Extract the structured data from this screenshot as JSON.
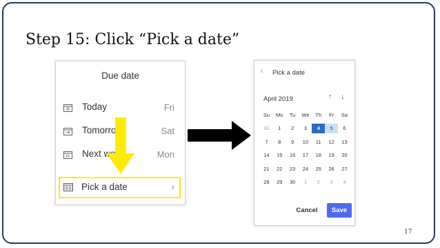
{
  "slide": {
    "title": "Step 15: Click “Pick a date”",
    "page_number": "17"
  },
  "due_date_panel": {
    "header": "Due date",
    "options": [
      {
        "label": "Today",
        "day": "Fri",
        "icon": "calendar-day-icon"
      },
      {
        "label": "Tomorrow",
        "day": "Sat",
        "icon": "calendar-arrow-icon"
      },
      {
        "label": "Next week",
        "day": "Mon",
        "icon": "calendar-next-week-icon"
      }
    ],
    "pick": {
      "label": "Pick a date",
      "chevron": "›",
      "icon": "calendar-icon"
    }
  },
  "calendar_panel": {
    "back": "‹",
    "header": "Pick a date",
    "month": "April 2019",
    "nav_up": "↑",
    "nav_down": "↓",
    "weekdays": [
      "Su",
      "Mo",
      "Tu",
      "We",
      "Th",
      "Fr",
      "Sa"
    ],
    "weeks": [
      [
        "31",
        "1",
        "2",
        "3",
        "4",
        "5",
        "6"
      ],
      [
        "7",
        "8",
        "9",
        "10",
        "11",
        "12",
        "13"
      ],
      [
        "14",
        "15",
        "16",
        "17",
        "18",
        "19",
        "20"
      ],
      [
        "21",
        "22",
        "23",
        "24",
        "25",
        "26",
        "27"
      ],
      [
        "28",
        "29",
        "30",
        "1",
        "2",
        "3",
        "4"
      ]
    ],
    "selected": "4",
    "today": "5",
    "cancel_label": "Cancel",
    "save_label": "Save"
  },
  "colors": {
    "highlight_yellow": "#ffeb00",
    "accent_blue": "#2b6cc4",
    "save_blue": "#4f6bed",
    "today_light_blue": "#c7e0f4",
    "slide_border": "#1f3864"
  }
}
